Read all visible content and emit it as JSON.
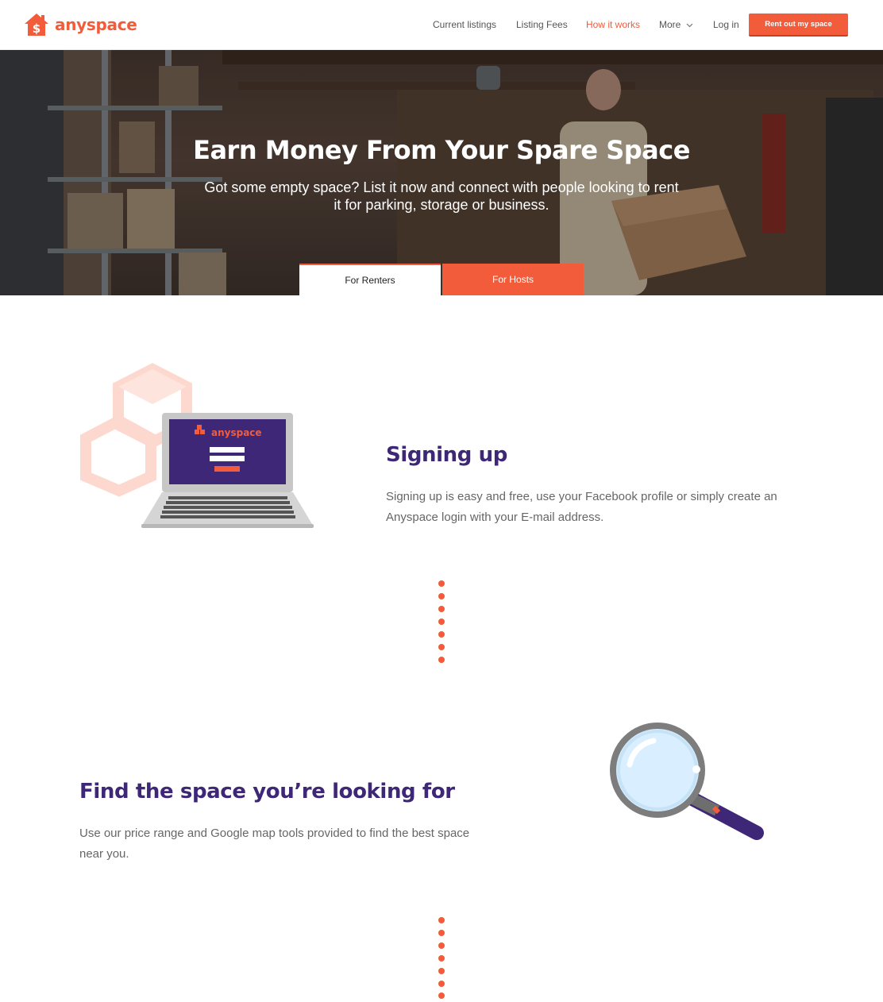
{
  "brand": {
    "name": "anyspace",
    "accent": "#f25c3b",
    "purple": "#3d2776"
  },
  "nav": {
    "items": [
      "Current listings",
      "Listing Fees",
      "How it works",
      "More",
      "Log in"
    ],
    "cta": "Rent out my space"
  },
  "hero": {
    "title": "Earn Money From Your Spare Space",
    "subtitle": "Got some empty space? List it now and connect with people looking to rent it for parking, storage or business.",
    "tabs": [
      "For Renters",
      "For Hosts"
    ]
  },
  "steps": [
    {
      "title": "Signing up",
      "text": "Signing up is easy and free, use your Facebook profile or simply create an Anyspace login with your E-mail address.",
      "illustration_brand": "anyspace"
    },
    {
      "title": "Find the space you’re looking for",
      "text": "Use our price range and Google map tools provided to find the best space near you."
    }
  ]
}
